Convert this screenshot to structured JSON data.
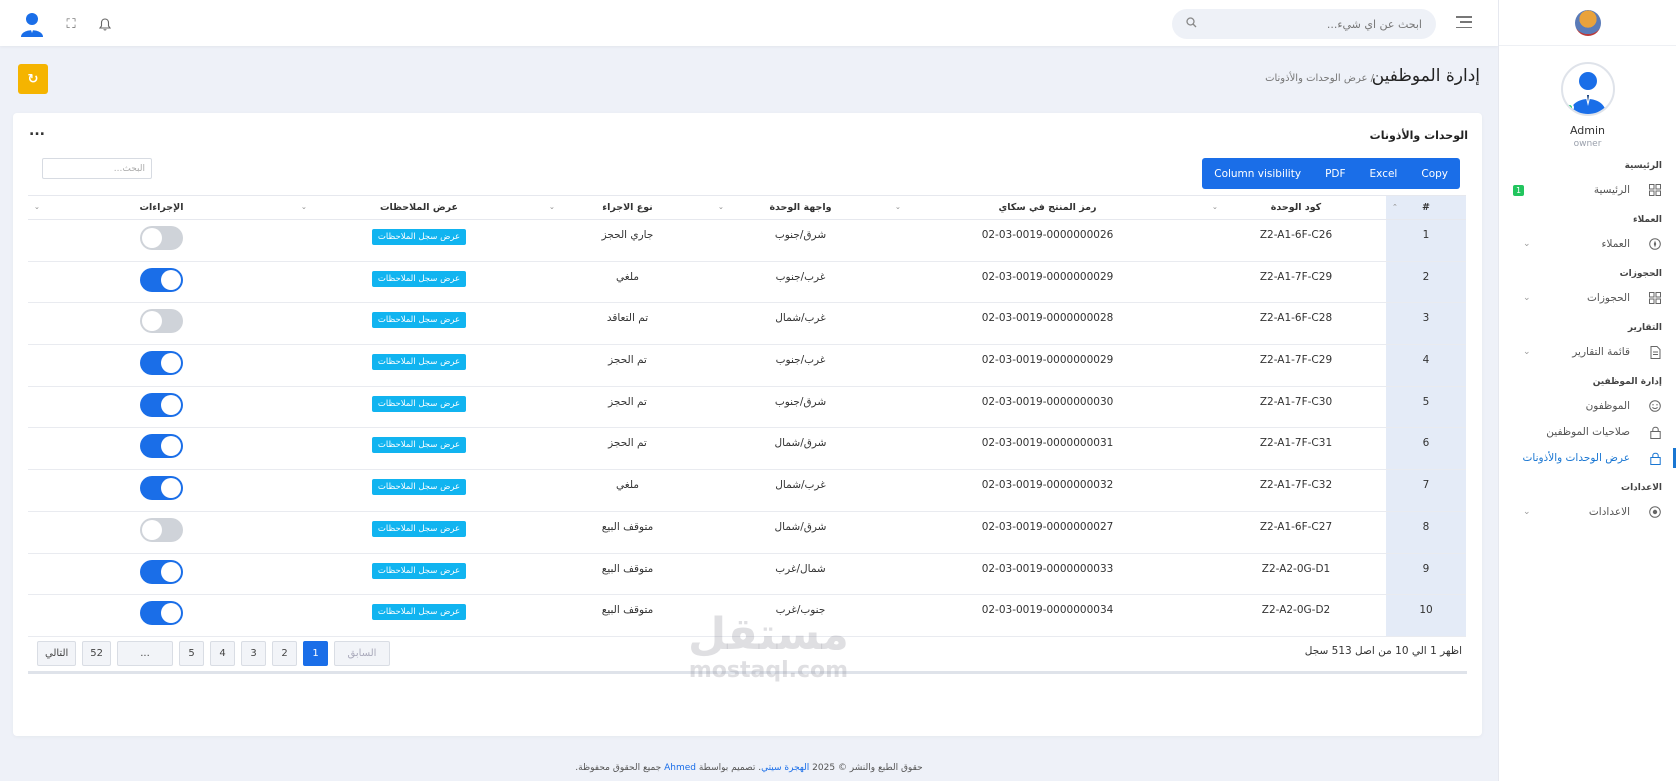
{
  "topbar": {
    "search_placeholder": "ابحث عن اي شيء..."
  },
  "sidebar": {
    "user_name": "Admin",
    "user_role": "owner",
    "sections": {
      "home": "الرئيسية",
      "clients": "العملاء",
      "bookings": "الحجوزات",
      "reports": "التقارير",
      "staff": "إدارة الموظفين",
      "settings": "الاعدادات"
    },
    "items": {
      "home": "الرئيسية",
      "home_badge": "1",
      "clients": "العملاء",
      "bookings": "الحجوزات",
      "reports_list": "قائمة التقارير",
      "employees": "الموظفون",
      "employee_permissions": "صلاحيات الموظفين",
      "units_permissions": "عرض الوحدات والأذونات",
      "settings": "الاعدادات"
    }
  },
  "page": {
    "title": "إدارة الموظفين",
    "breadcrumb": "/ عرض الوحدات والأذونات",
    "refresh_icon": "refresh-icon"
  },
  "card": {
    "title": "الوحدات والأذونات",
    "more": "..."
  },
  "export_buttons": {
    "copy": "Copy",
    "excel": "Excel",
    "pdf": "PDF",
    "column_visibility": "Column visibility"
  },
  "table_search": {
    "placeholder": "البحث..."
  },
  "table": {
    "headers": {
      "num": "#",
      "unit_code": "كود الوحدة",
      "sku": "رمز المنتج في سكاي",
      "facade": "واجهة الوحدة",
      "action_type": "نوع الاجراء",
      "notes": "عرض الملاحظات",
      "actions": "الإجراءات"
    },
    "notes_button_label": "عرض سجل الملاحظات",
    "rows": [
      {
        "num": "1",
        "unit_code": "Z2-A1-6F-C26",
        "sku": "02-03-0019-0000000026",
        "facade": "شرق/جنوب",
        "action_type": "جاري الحجز",
        "enabled": false
      },
      {
        "num": "2",
        "unit_code": "Z2-A1-7F-C29",
        "sku": "02-03-0019-0000000029",
        "facade": "غرب/جنوب",
        "action_type": "ملغي",
        "enabled": true
      },
      {
        "num": "3",
        "unit_code": "Z2-A1-6F-C28",
        "sku": "02-03-0019-0000000028",
        "facade": "غرب/شمال",
        "action_type": "تم التعاقد",
        "enabled": false
      },
      {
        "num": "4",
        "unit_code": "Z2-A1-7F-C29",
        "sku": "02-03-0019-0000000029",
        "facade": "غرب/جنوب",
        "action_type": "تم الحجز",
        "enabled": true
      },
      {
        "num": "5",
        "unit_code": "Z2-A1-7F-C30",
        "sku": "02-03-0019-0000000030",
        "facade": "شرق/جنوب",
        "action_type": "تم الحجز",
        "enabled": true
      },
      {
        "num": "6",
        "unit_code": "Z2-A1-7F-C31",
        "sku": "02-03-0019-0000000031",
        "facade": "شرق/شمال",
        "action_type": "تم الحجز",
        "enabled": true
      },
      {
        "num": "7",
        "unit_code": "Z2-A1-7F-C32",
        "sku": "02-03-0019-0000000032",
        "facade": "غرب/شمال",
        "action_type": "ملغي",
        "enabled": true
      },
      {
        "num": "8",
        "unit_code": "Z2-A1-6F-C27",
        "sku": "02-03-0019-0000000027",
        "facade": "شرق/شمال",
        "action_type": "متوقف البيع",
        "enabled": false
      },
      {
        "num": "9",
        "unit_code": "Z2-A2-0G-D1",
        "sku": "02-03-0019-0000000033",
        "facade": "شمال/غرب",
        "action_type": "متوقف البيع",
        "enabled": true
      },
      {
        "num": "10",
        "unit_code": "Z2-A2-0G-D2",
        "sku": "02-03-0019-0000000034",
        "facade": "جنوب/غرب",
        "action_type": "متوقف البيع",
        "enabled": true
      }
    ]
  },
  "table_info": "اظهر 1 الي 10 من اصل 513 سجل",
  "pagination": {
    "next": "التالي",
    "last": "52",
    "ellipsis": "...",
    "pages": [
      "5",
      "4",
      "3",
      "2",
      "1"
    ],
    "prev": "السابق",
    "active": "1"
  },
  "watermark": {
    "arabic": "مستقل",
    "latin": "mostaql.com"
  },
  "footer": {
    "prefix": "حقوق الطبع والنشر © 2025",
    "brand": "الهجرة سيتي",
    "middle": ". تصميم بواسطة",
    "author": "Ahmed",
    "suffix": "جميع الحقوق محفوظة."
  },
  "colors": {
    "primary": "#1a6ee8",
    "notes_button": "#11b4f0",
    "refresh_button": "#f5b400",
    "badge": "#22c55e"
  }
}
